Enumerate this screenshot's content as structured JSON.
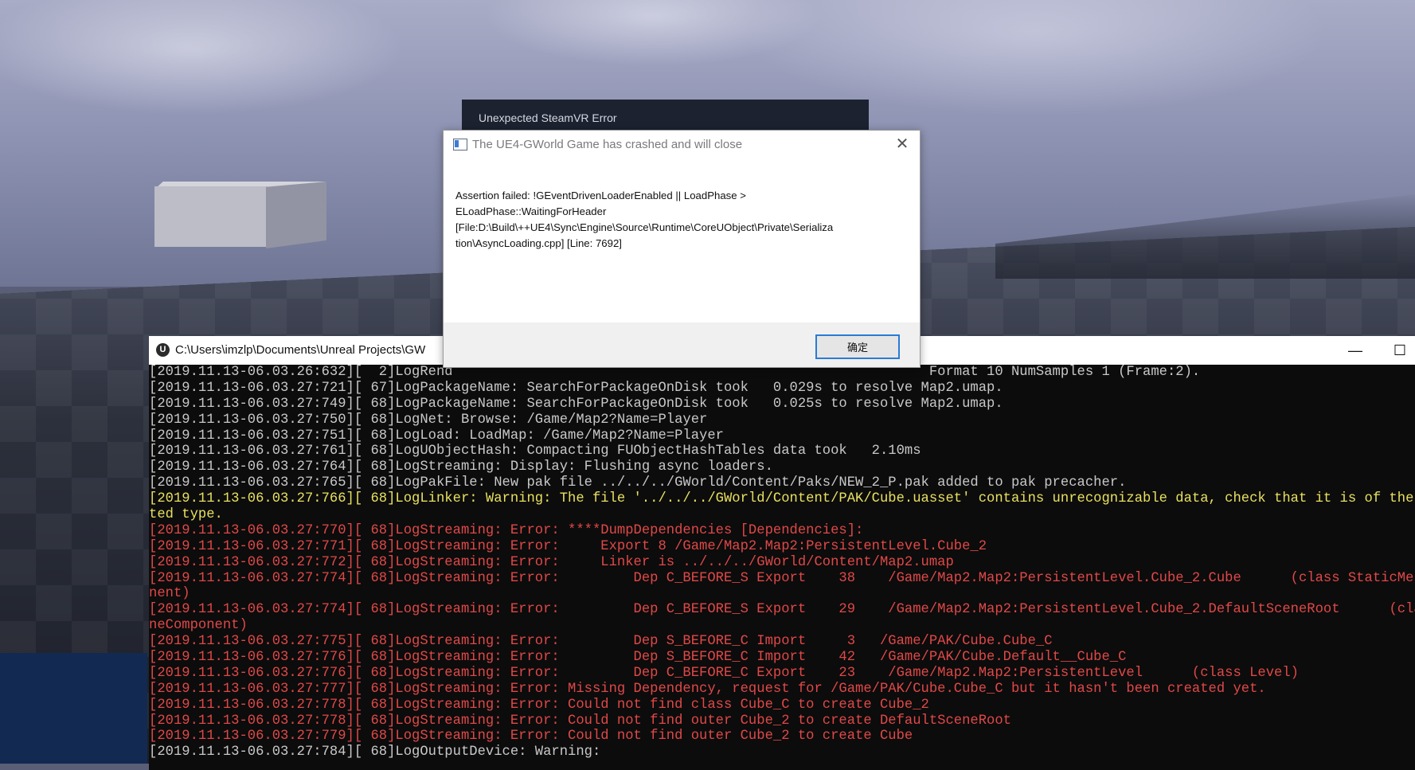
{
  "steamvr_error": {
    "title": "Unexpected SteamVR Error"
  },
  "dialog": {
    "title": "The UE4-GWorld Game has crashed and will close",
    "close_glyph": "✕",
    "message": "Assertion failed: !GEventDrivenLoaderEnabled || LoadPhase >\nELoadPhase::WaitingForHeader\n[File:D:\\Build\\++UE4\\Sync\\Engine\\Source\\Runtime\\CoreUObject\\Private\\Serializa\ntion\\AsyncLoading.cpp] [Line: 7692]",
    "ok_label": "确定"
  },
  "console": {
    "title": "C:\\Users\\imzlp\\Documents\\Unreal Projects\\GW",
    "minimize_glyph": "—",
    "maximize_glyph": "☐",
    "close_glyph": "✕",
    "lines": [
      {
        "kind": "normal",
        "text": "[2019.11.13-06.03.26:632][  2]LogRend                                                          Format 10 NumSamples 1 (Frame:2)."
      },
      {
        "kind": "normal",
        "text": "[2019.11.13-06.03.27:721][ 67]LogPackageName: SearchForPackageOnDisk took   0.029s to resolve Map2.umap."
      },
      {
        "kind": "normal",
        "text": "[2019.11.13-06.03.27:749][ 68]LogPackageName: SearchForPackageOnDisk took   0.025s to resolve Map2.umap."
      },
      {
        "kind": "normal",
        "text": "[2019.11.13-06.03.27:750][ 68]LogNet: Browse: /Game/Map2?Name=Player"
      },
      {
        "kind": "normal",
        "text": "[2019.11.13-06.03.27:751][ 68]LogLoad: LoadMap: /Game/Map2?Name=Player"
      },
      {
        "kind": "normal",
        "text": "[2019.11.13-06.03.27:761][ 68]LogUObjectHash: Compacting FUObjectHashTables data took   2.10ms"
      },
      {
        "kind": "normal",
        "text": "[2019.11.13-06.03.27:764][ 68]LogStreaming: Display: Flushing async loaders."
      },
      {
        "kind": "normal",
        "text": "[2019.11.13-06.03.27:765][ 68]LogPakFile: New pak file ../../../GWorld/Content/Paks/NEW_2_P.pak added to pak precacher."
      },
      {
        "kind": "warning",
        "text": "[2019.11.13-06.03.27:766][ 68]LogLinker: Warning: The file '../../../GWorld/Content/PAK/Cube.uasset' contains unrecognizable data, check that it is of the expec"
      },
      {
        "kind": "warning",
        "text": "ted type."
      },
      {
        "kind": "error",
        "text": "[2019.11.13-06.03.27:770][ 68]LogStreaming: Error: ****DumpDependencies [Dependencies]:"
      },
      {
        "kind": "error",
        "text": "[2019.11.13-06.03.27:771][ 68]LogStreaming: Error:     Export 8 /Game/Map2.Map2:PersistentLevel.Cube_2"
      },
      {
        "kind": "error",
        "text": "[2019.11.13-06.03.27:772][ 68]LogStreaming: Error:     Linker is ../../../GWorld/Content/Map2.umap"
      },
      {
        "kind": "error",
        "text": "[2019.11.13-06.03.27:774][ 68]LogStreaming: Error:         Dep C_BEFORE_S Export    38    /Game/Map2.Map2:PersistentLevel.Cube_2.Cube      (class StaticMeshCompo"
      },
      {
        "kind": "error",
        "text": "nent)"
      },
      {
        "kind": "error",
        "text": "[2019.11.13-06.03.27:774][ 68]LogStreaming: Error:         Dep C_BEFORE_S Export    29    /Game/Map2.Map2:PersistentLevel.Cube_2.DefaultSceneRoot      (class Sce"
      },
      {
        "kind": "error",
        "text": "neComponent)"
      },
      {
        "kind": "error",
        "text": "[2019.11.13-06.03.27:775][ 68]LogStreaming: Error:         Dep S_BEFORE_C Import     3   /Game/PAK/Cube.Cube_C"
      },
      {
        "kind": "error",
        "text": "[2019.11.13-06.03.27:776][ 68]LogStreaming: Error:         Dep S_BEFORE_C Import    42   /Game/PAK/Cube.Default__Cube_C"
      },
      {
        "kind": "error",
        "text": "[2019.11.13-06.03.27:776][ 68]LogStreaming: Error:         Dep C_BEFORE_C Export    23    /Game/Map2.Map2:PersistentLevel      (class Level)"
      },
      {
        "kind": "error",
        "text": "[2019.11.13-06.03.27:777][ 68]LogStreaming: Error: Missing Dependency, request for /Game/PAK/Cube.Cube_C but it hasn't been created yet."
      },
      {
        "kind": "error",
        "text": "[2019.11.13-06.03.27:778][ 68]LogStreaming: Error: Could not find class Cube_C to create Cube_2"
      },
      {
        "kind": "error",
        "text": "[2019.11.13-06.03.27:778][ 68]LogStreaming: Error: Could not find outer Cube_2 to create DefaultSceneRoot"
      },
      {
        "kind": "error",
        "text": "[2019.11.13-06.03.27:779][ 68]LogStreaming: Error: Could not find outer Cube_2 to create Cube"
      },
      {
        "kind": "normal",
        "text": "[2019.11.13-06.03.27:784][ 68]LogOutputDevice: Warning:"
      }
    ]
  }
}
